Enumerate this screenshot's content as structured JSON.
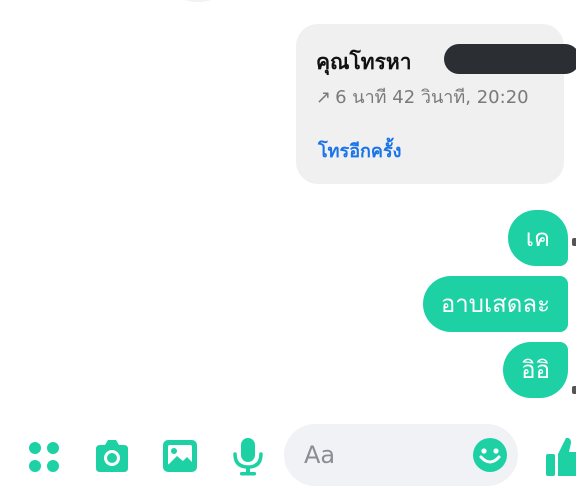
{
  "call_card": {
    "title": "คุณโทรหา",
    "duration_arrow": "↗",
    "duration_time": "6 นาที 42 วินาที, 20:20",
    "action_label": "โทรอีกครั้ง"
  },
  "messages": [
    {
      "text": "เค"
    },
    {
      "text": "อาบเสดละ"
    },
    {
      "text": "อิอิ"
    }
  ],
  "composer": {
    "placeholder": "Aa",
    "icons": [
      "apps-icon",
      "camera-icon",
      "image-icon",
      "microphone-icon",
      "emoji-icon",
      "thumbs-up-icon"
    ]
  },
  "colors": {
    "accent": "#1ed1a4",
    "link": "#1a74e8",
    "card_bg": "#f0f0f0",
    "input_bg": "#f0f2f5"
  }
}
